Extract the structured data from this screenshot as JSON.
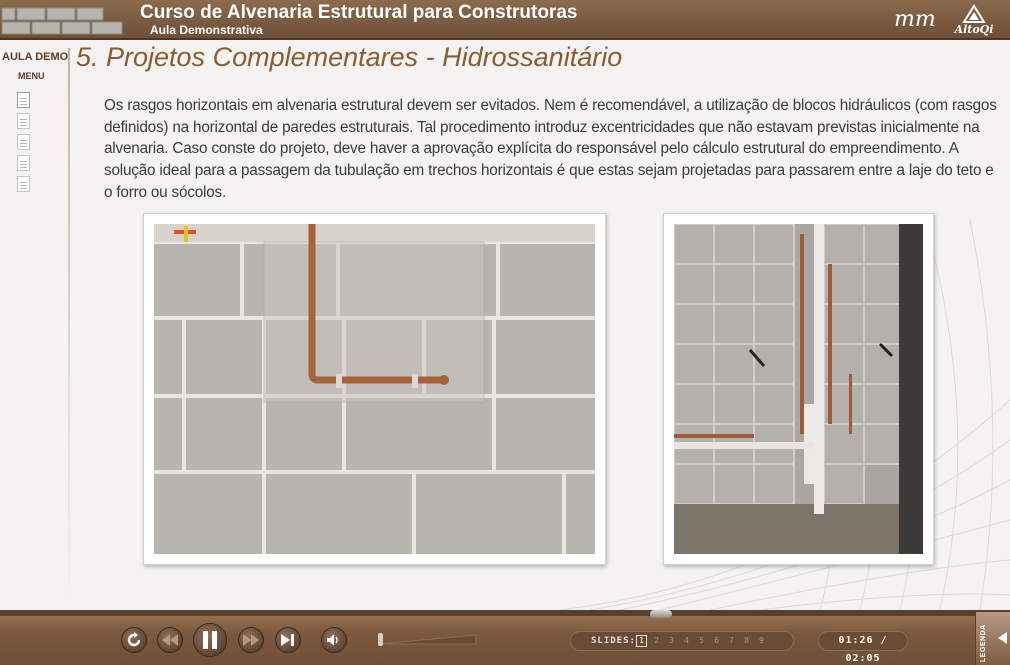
{
  "header": {
    "title": "Curso de Alvenaria Estrutural para Construtoras",
    "subtitle": "Aula Demonstrativa",
    "logo_mm": "mm",
    "logo_altoqi": "AltoQi"
  },
  "sidebar": {
    "aula_label": "AULA DEMO",
    "menu_label": "MENU",
    "items": [
      {
        "icon": "document-icon",
        "active": true
      },
      {
        "icon": "document-icon",
        "active": false
      },
      {
        "icon": "document-icon",
        "active": false
      },
      {
        "icon": "document-icon",
        "active": false
      },
      {
        "icon": "document-icon",
        "active": false
      }
    ]
  },
  "main": {
    "title": "5. Projetos Complementares - Hidrossanitário",
    "paragraph": "Os rasgos horizontais em alvenaria estrutural devem ser evitados. Nem é recomendável, a utilização de blocos hidráulicos (com rasgos definidos) na horizontal de paredes estruturais. Tal procedimento introduz excentricidades que não estavam previstas inicialmente na alvenaria. Caso conste do projeto, deve haver a aprovação explícita do responsável pelo cálculo estrutural do empreendimento. A solução ideal para a passagem da tubulação em trechos horizontais é que estas sejam projetadas para passarem entre a laje do teto e o forro ou sócolos."
  },
  "player": {
    "slides_label": "SLIDES:",
    "current_slide": "1",
    "slide_numbers": [
      "1",
      "2",
      "3",
      "4",
      "5",
      "6",
      "7",
      "8",
      "9"
    ],
    "time": "01:26 / 02:05",
    "legend_label": "LEGENDA",
    "accent": "#7b593f"
  }
}
